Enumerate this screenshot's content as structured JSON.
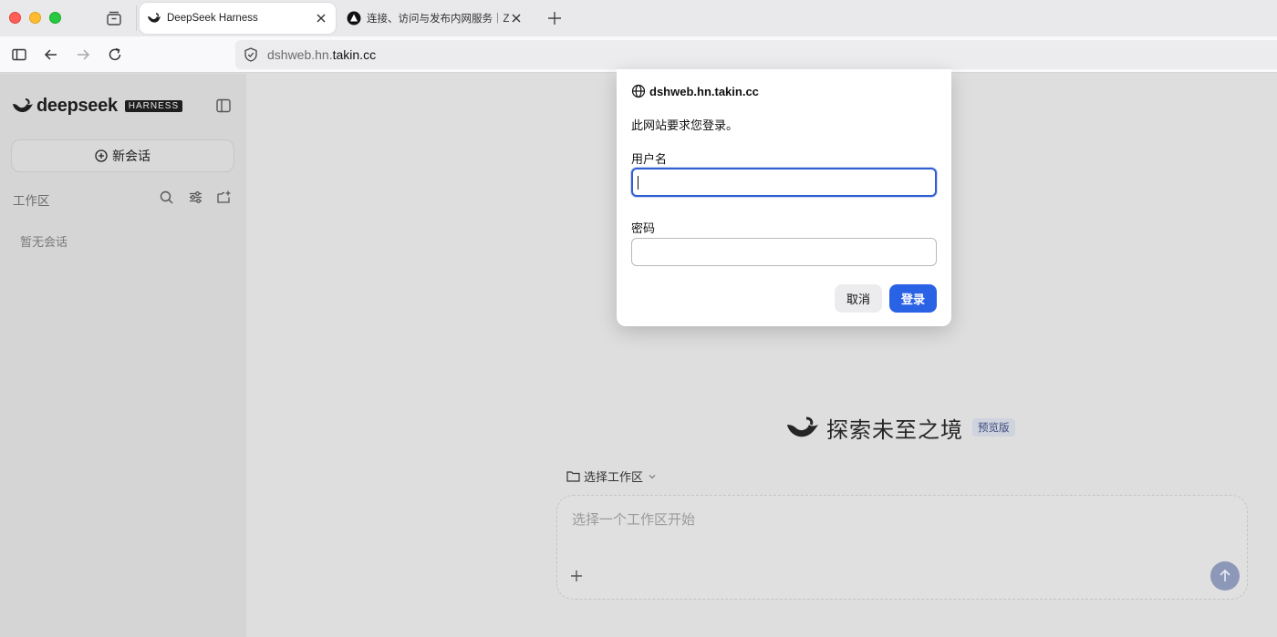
{
  "browser": {
    "tabs": [
      {
        "title": "DeepSeek Harness",
        "active": true
      },
      {
        "title": "连接、访问与发布内网服务｜Zero",
        "active": false
      }
    ],
    "url": {
      "prefix": "dshweb.hn.",
      "domain": "takin.cc"
    }
  },
  "sidebar": {
    "brand": "deepseek",
    "badge": "HARNESS",
    "new_chat": "新会话",
    "workspace_label": "工作区",
    "empty_text": "暂无会话"
  },
  "main": {
    "hero_title": "探索未至之境",
    "preview_badge": "预览版",
    "workspace_select": "选择工作区",
    "composer_placeholder": "选择一个工作区开始"
  },
  "auth_dialog": {
    "host": "dshweb.hn.takin.cc",
    "message": "此网站要求您登录。",
    "username_label": "用户名",
    "username_value": "",
    "password_label": "密码",
    "password_value": "",
    "cancel": "取消",
    "login": "登录"
  },
  "colors": {
    "accent": "#2a62e6",
    "send_button": "#8d98b8",
    "focus_ring": "#2f5fd0"
  }
}
